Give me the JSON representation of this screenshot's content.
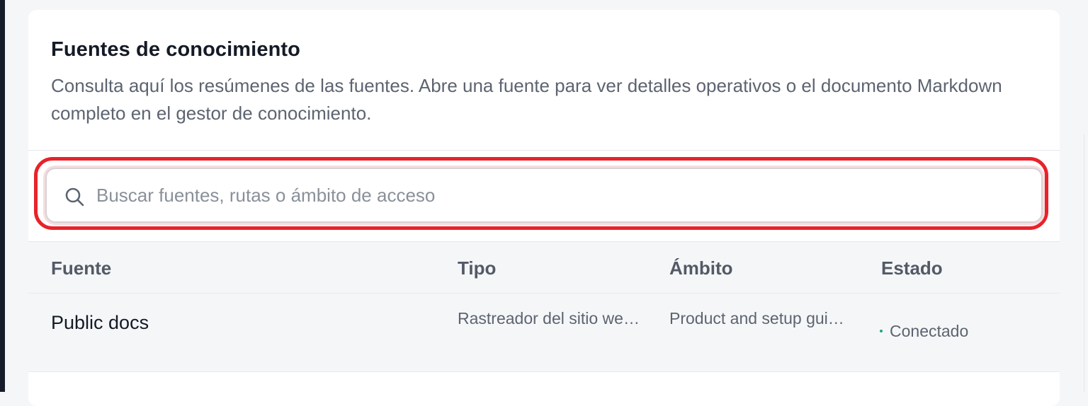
{
  "panel": {
    "title": "Fuentes de conocimiento",
    "description": "Consulta aquí los resúmenes de las fuentes. Abre una fuente para ver detalles operativos o el documento Markdown completo en el gestor de conocimiento."
  },
  "search": {
    "placeholder": "Buscar fuentes, rutas o ámbito de acceso",
    "value": "",
    "icon": "search-icon",
    "highlight_color": "#e8222b"
  },
  "table": {
    "columns": [
      "Fuente",
      "Tipo",
      "Ámbito",
      "Estado"
    ],
    "rows": [
      {
        "source": "Public docs",
        "type": "Rastreador del sitio we…",
        "scope": "Product and setup gui…",
        "status": "Conectado",
        "status_color": "#22a57a"
      }
    ]
  }
}
